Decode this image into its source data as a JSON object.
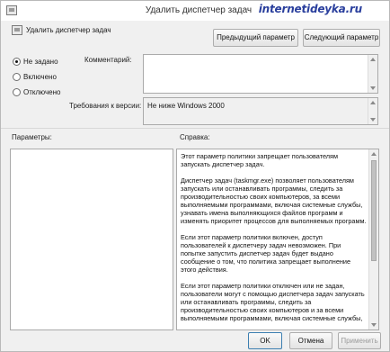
{
  "window": {
    "title": "Удалить диспетчер задач",
    "watermark": "internetideyka.ru",
    "subtitle": "Удалить диспетчер задач"
  },
  "nav": {
    "prev_label": "Предыдущий параметр",
    "next_label": "Следующий параметр"
  },
  "state": {
    "options": [
      {
        "label": "Не задано",
        "checked": true
      },
      {
        "label": "Включено",
        "checked": false
      },
      {
        "label": "Отключено",
        "checked": false
      }
    ]
  },
  "comment": {
    "label": "Комментарий:",
    "value": ""
  },
  "requirements": {
    "label": "Требования к версии:",
    "value": "Не ниже Windows 2000"
  },
  "sections": {
    "params_label": "Параметры:",
    "help_label": "Справка:"
  },
  "help": {
    "paragraphs": [
      "Этот параметр политики запрещает пользователям запускать диспетчер задач.",
      "Диспетчер задач (taskmgr.exe) позволяет пользователям запускать или останавливать программы, следить за производительностью своих компьютеров, за всеми выполняемыми программами, включая системные службы, узнавать имена выполняющихся файлов программ и изменять приоритет процессов для выполняемых программ.",
      "Если этот параметр политики включен, доступ пользователей к диспетчеру задач невозможен. При попытке запустить диспетчер задач будет выдано сообщение о том, что политика запрещает выполнение этого действия.",
      "Если этот параметр политики отключен или не задан, пользователи могут с помощью диспетчера задач запускать или останавливать программы, следить за производительностью своих компьютеров и за всеми выполняемыми программами, включая системные службы,"
    ]
  },
  "buttons": {
    "ok_label": "OK",
    "cancel_label": "Отмена",
    "apply_label": "Применить"
  }
}
